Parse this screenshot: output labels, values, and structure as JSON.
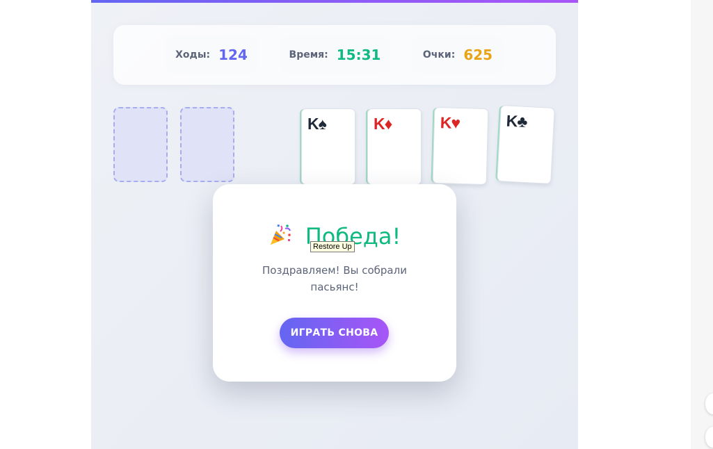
{
  "stats": [
    {
      "label": "Ходы:",
      "value": "124",
      "color": "#6366f1"
    },
    {
      "label": "Время:",
      "value": "15:31",
      "color": "#10b981"
    },
    {
      "label": "Очки:",
      "value": "625",
      "color": "#e8a317"
    }
  ],
  "foundations": [
    {
      "rank": "K",
      "suit": "♠",
      "color": "#1f2937"
    },
    {
      "rank": "K",
      "suit": "♦",
      "color": "#dc2626"
    },
    {
      "rank": "K",
      "suit": "♥",
      "color": "#dc2626"
    },
    {
      "rank": "K",
      "suit": "♣",
      "color": "#1f2937"
    }
  ],
  "dialog": {
    "icon": "party-popper-icon",
    "title": "Победа!",
    "message": "Поздравляем! Вы собрали пасьянс!",
    "button": "ИГРАТЬ СНОВА"
  },
  "tooltip": "Restore Up",
  "colors": {
    "accent_start": "#6366f1",
    "accent_end": "#a855f7",
    "success": "#10b981"
  }
}
